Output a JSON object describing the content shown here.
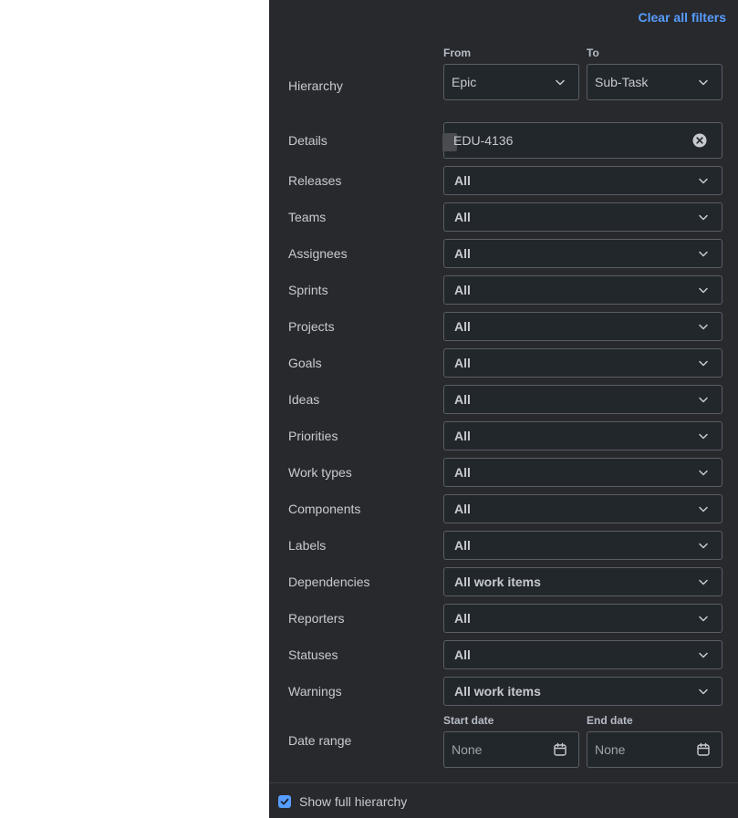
{
  "panel": {
    "clear_all": "Clear all filters",
    "hierarchy": {
      "label": "Hierarchy",
      "from_label": "From",
      "to_label": "To",
      "from_value": "Epic",
      "to_value": "Sub-Task"
    },
    "details": {
      "label": "Details",
      "value": "EDU-4136"
    },
    "filters": [
      {
        "label": "Releases",
        "value": "All"
      },
      {
        "label": "Teams",
        "value": "All"
      },
      {
        "label": "Assignees",
        "value": "All"
      },
      {
        "label": "Sprints",
        "value": "All"
      },
      {
        "label": "Projects",
        "value": "All"
      },
      {
        "label": "Goals",
        "value": "All"
      },
      {
        "label": "Ideas",
        "value": "All"
      },
      {
        "label": "Priorities",
        "value": "All"
      },
      {
        "label": "Work types",
        "value": "All"
      },
      {
        "label": "Components",
        "value": "All"
      },
      {
        "label": "Labels",
        "value": "All"
      },
      {
        "label": "Dependencies",
        "value": "All work items"
      },
      {
        "label": "Reporters",
        "value": "All"
      },
      {
        "label": "Statuses",
        "value": "All"
      },
      {
        "label": "Warnings",
        "value": "All work items"
      }
    ],
    "date_range": {
      "label": "Date range",
      "start_label": "Start date",
      "end_label": "End date",
      "start_value": "None",
      "end_value": "None"
    },
    "show_full_hierarchy": {
      "label": "Show full hierarchy",
      "checked": true
    }
  },
  "colors": {
    "panel_bg": "#28292d",
    "accent": "#579dff",
    "field_bg": "#22272b",
    "field_border": "#5b5e66"
  }
}
